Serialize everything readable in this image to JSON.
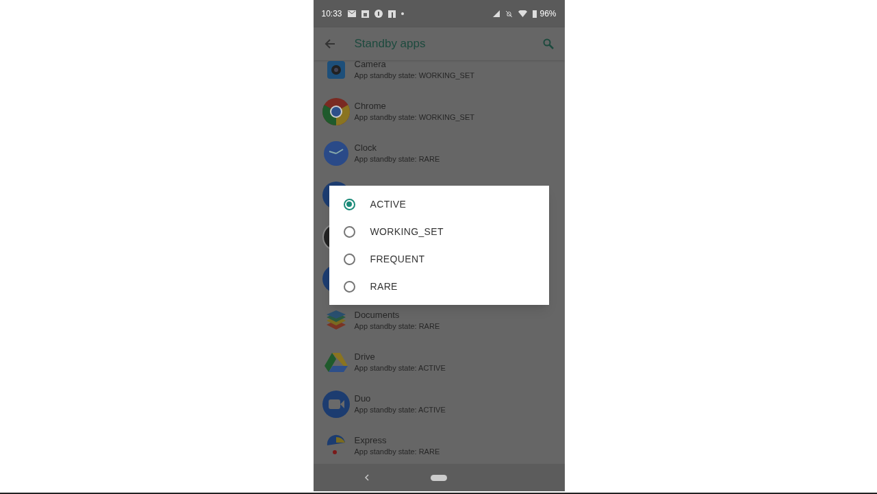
{
  "status_bar": {
    "time": "10:33",
    "battery": "96%"
  },
  "toolbar": {
    "title": "Standby apps"
  },
  "apps": [
    {
      "kind": "app",
      "name": "Camera",
      "state": "App standby state: WORKING_SET"
    },
    {
      "kind": "app",
      "name": "Chrome",
      "state": "App standby state: WORKING_SET"
    },
    {
      "kind": "app",
      "name": "Clock",
      "state": "App standby state: RARE"
    },
    {
      "kind": "covered"
    },
    {
      "kind": "covered"
    },
    {
      "kind": "covered"
    },
    {
      "kind": "app",
      "name": "Documents",
      "state": "App standby state: RARE"
    },
    {
      "kind": "app",
      "name": "Drive",
      "state": "App standby state: ACTIVE"
    },
    {
      "kind": "app",
      "name": "Duo",
      "state": "App standby state: ACTIVE"
    },
    {
      "kind": "app",
      "name": "Express",
      "state": "App standby state: RARE"
    }
  ],
  "dialog": {
    "options": [
      {
        "label": "ACTIVE",
        "selected": true
      },
      {
        "label": "WORKING_SET",
        "selected": false
      },
      {
        "label": "FREQUENT",
        "selected": false
      },
      {
        "label": "RARE",
        "selected": false
      }
    ]
  }
}
